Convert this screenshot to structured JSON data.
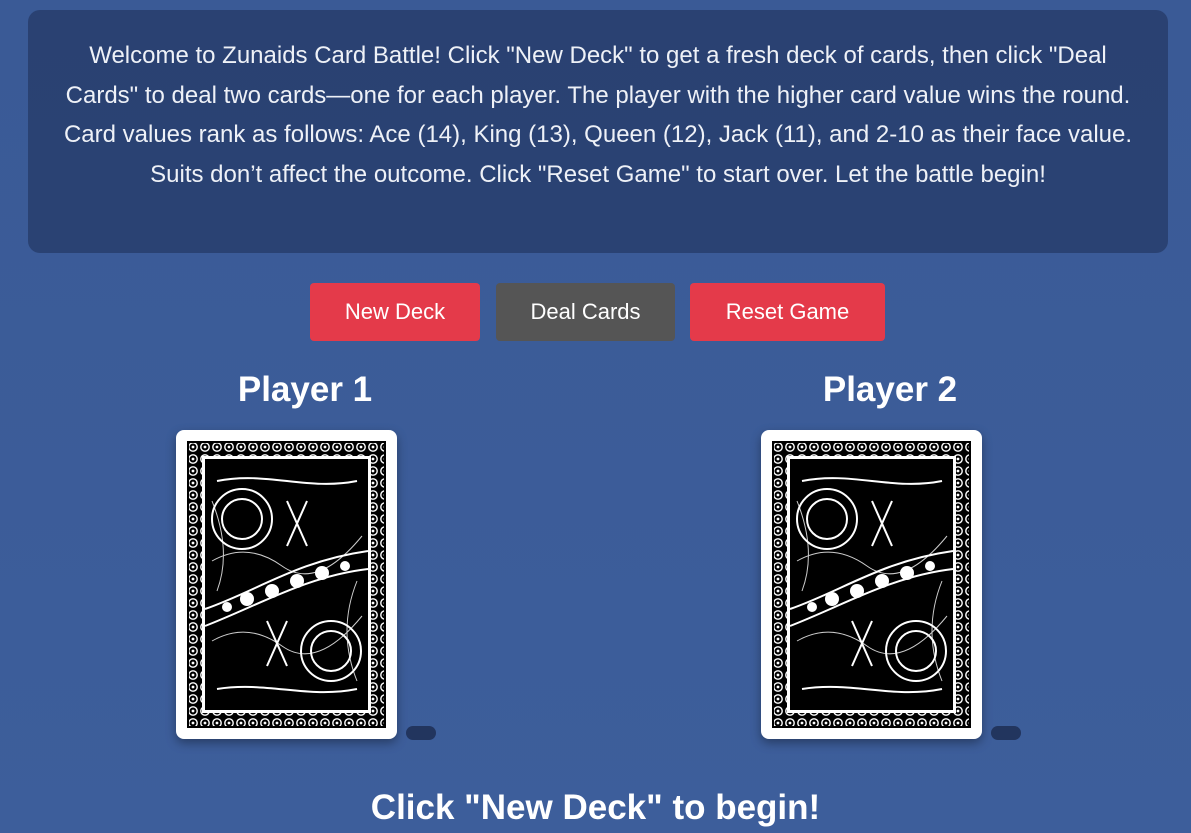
{
  "intro": {
    "text": "Welcome to Zunaids Card Battle! Click \"New Deck\" to get a fresh deck of cards, then click \"Deal Cards\" to deal two cards—one for each player. The player with the higher card value wins the round. Card values rank as follows: Ace (14), King (13), Queen (12), Jack (11), and 2-10 as their face value. Suits don’t affect the outcome. Click \"Reset Game\" to start over. Let the battle begin!"
  },
  "controls": {
    "new_deck": "New Deck",
    "deal_cards": "Deal Cards",
    "reset_game": "Reset Game"
  },
  "players": [
    {
      "name": "Player 1",
      "card": "card-back"
    },
    {
      "name": "Player 2",
      "card": "card-back"
    }
  ],
  "status": "Click \"New Deck\" to begin!",
  "colors": {
    "background": "#3a5a96",
    "accent_red": "#e43a4a",
    "button_gray": "#555555"
  }
}
